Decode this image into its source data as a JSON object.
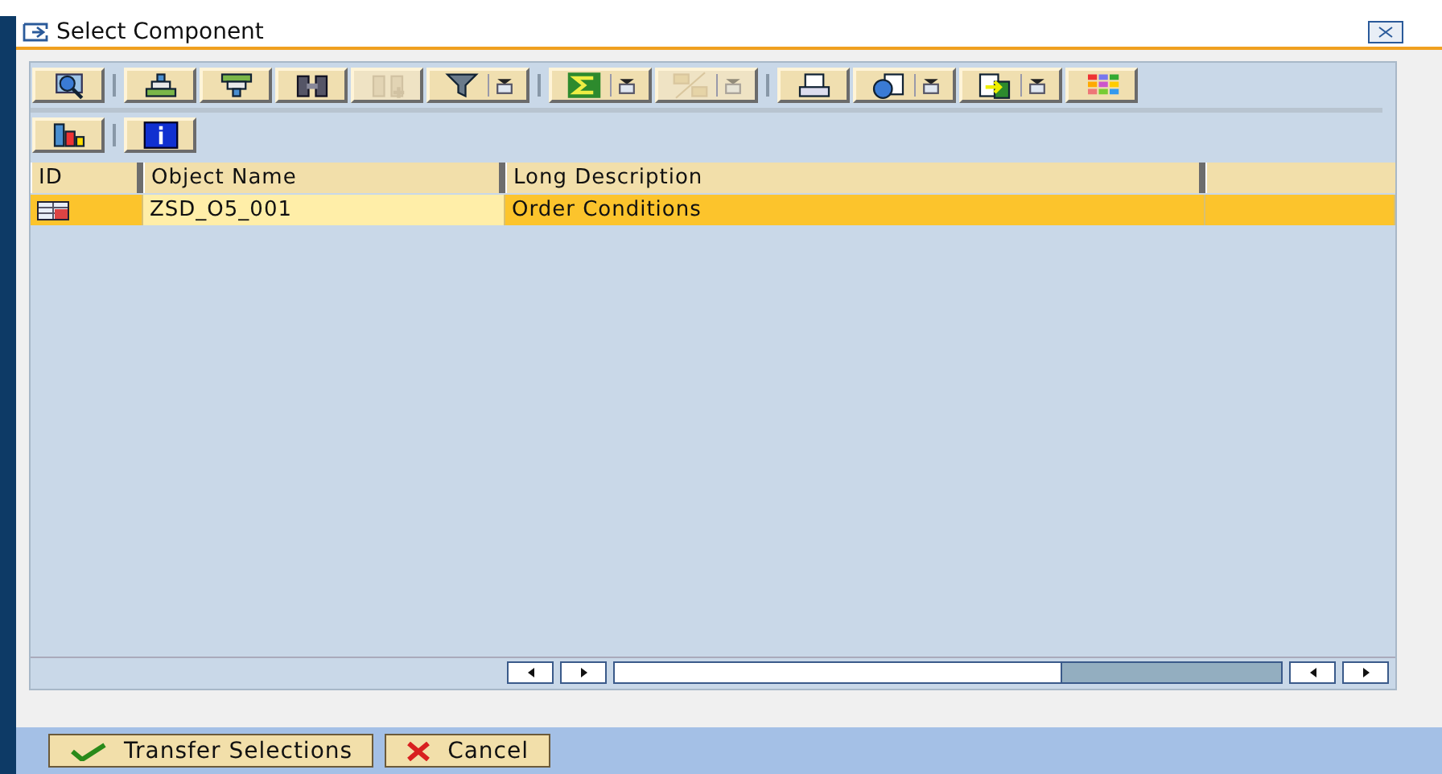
{
  "window": {
    "title": "Select Component"
  },
  "toolbar_rows": [
    [
      [
        {
          "disabled": false,
          "menu": false
        }
      ],
      [
        {
          "disabled": false,
          "menu": false
        },
        {
          "disabled": false,
          "menu": false
        },
        {
          "disabled": false,
          "menu": false
        },
        {
          "disabled": true,
          "menu": false
        },
        {
          "disabled": false,
          "menu": true
        }
      ],
      [
        {
          "disabled": false,
          "menu": true
        },
        {
          "disabled": true,
          "menu": true
        }
      ],
      [
        {
          "disabled": false,
          "menu": false
        },
        {
          "disabled": false,
          "menu": true
        },
        {
          "disabled": false,
          "menu": true
        },
        {
          "disabled": false,
          "menu": false
        }
      ]
    ],
    [
      [
        {
          "disabled": false,
          "menu": false
        }
      ],
      [
        {
          "disabled": false,
          "menu": false
        }
      ]
    ]
  ],
  "table": {
    "columns": [
      "ID",
      "Object Name",
      "Long Description"
    ],
    "rows": [
      {
        "selected": true,
        "cells": [
          "",
          "ZSD_O5_001",
          "Order Conditions"
        ]
      }
    ]
  },
  "buttons": [
    {
      "label": "Transfer Selections",
      "kind": "confirm"
    },
    {
      "label": "Cancel",
      "kind": "cancel"
    }
  ]
}
